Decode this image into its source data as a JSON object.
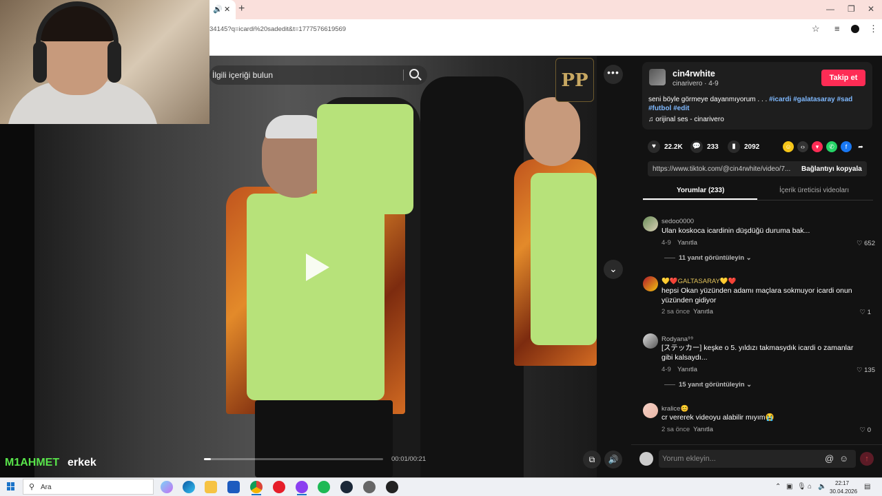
{
  "browser": {
    "url": "34145?q=icardi%20sadedit&t=1777576619569",
    "tab_audio_icon": "speaker-icon",
    "new_tab_label": "+"
  },
  "search": {
    "placeholder": "İlgili içeriği bulun"
  },
  "video": {
    "logo_text": "PP",
    "time": "00:01/00:21",
    "progress": 0.04
  },
  "overlay": {
    "name": "M1AHMET",
    "gender": "erkek"
  },
  "author": {
    "username": "cin4rwhite",
    "subline": "cinarivero · 4-9",
    "follow_label": "Takip et"
  },
  "caption": {
    "text": "seni böyle görmeye dayanmıyorum . . . ",
    "tags_line1": "#icardi #galatasaray #sad",
    "tags_line2": "#futbol #edit"
  },
  "sound": "orijinal ses - cinarivero",
  "stats": {
    "likes": "22.2K",
    "comments": "233",
    "saves": "2092"
  },
  "link": {
    "url": "https://www.tiktok.com/@cin4rwhite/video/7...",
    "copy_label": "Bağlantıyı kopyala"
  },
  "tabs": {
    "comments": "Yorumlar (233)",
    "creator": "İçerik üreticisi videoları"
  },
  "comments": [
    {
      "user": "sedoo0000",
      "text": "Ulan koskoca icardinin düşdüğü duruma bak...",
      "time": "4-9",
      "reply": "Yanıtla",
      "likes": "652",
      "more": "11 yanıt görüntüleyin"
    },
    {
      "user": "💛❤️GALTASARAY💛❤️",
      "text": "hepsi Okan yüzünden adamı maçlara sokmuyor icardi onun yüzünden gidiyor",
      "time": "2 sa önce",
      "reply": "Yanıtla",
      "likes": "1",
      "more": ""
    },
    {
      "user": "Rodyana⁹⁹",
      "text": "[ステッカー] keşke o 5. yıldızı takmasydık icardi o zamanlar gibi kalsaydı...",
      "time": "4-9",
      "reply": "Yanıtla",
      "likes": "135",
      "more": "15 yanıt görüntüleyin"
    },
    {
      "user": "kralice😊",
      "text": "cr vererek videoyu alabilir mıyım😭",
      "time": "2 sa önce",
      "reply": "Yanıtla",
      "likes": "0",
      "more": ""
    }
  ],
  "comment_input": {
    "placeholder": "Yorum ekleyin..."
  },
  "taskbar": {
    "search_text": "Ara",
    "time": "22:17",
    "date": "30.04.2026"
  },
  "colors": {
    "accent": "#fe2c55",
    "tag": "#7fb9ff",
    "overlay_name": "#58e34a"
  }
}
